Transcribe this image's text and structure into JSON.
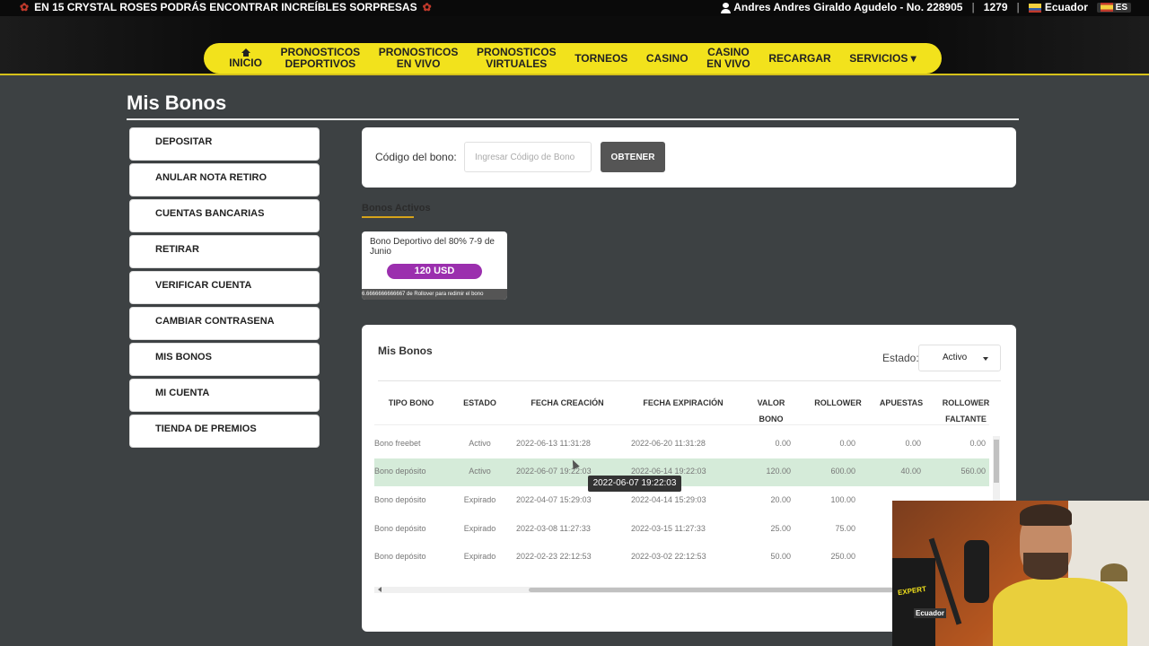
{
  "topbar": {
    "promo_text": "EN 15 CRYSTAL ROSES PODRÁS ENCONTRAR INCREÍBLES SORPRESAS",
    "user_name": "Andres Andres Giraldo Agudelo - No. 228905",
    "balance": "1279",
    "country": "Ecuador",
    "language": "ES"
  },
  "nav": [
    {
      "label": "INICIO",
      "icon": "home-icon"
    },
    {
      "label": "PRONOSTICOS\nDEPORTIVOS"
    },
    {
      "label": "PRONOSTICOS\nEN VIVO"
    },
    {
      "label": "PRONOSTICOS\nVIRTUALES"
    },
    {
      "label": "TORNEOS"
    },
    {
      "label": "CASINO"
    },
    {
      "label": "CASINO\nEN VIVO"
    },
    {
      "label": "RECARGAR"
    },
    {
      "label": "SERVICIOS ▾"
    }
  ],
  "page_title": "Mis Bonos",
  "sidebar": {
    "items": [
      {
        "label": "DEPOSITAR"
      },
      {
        "label": "ANULAR NOTA RETIRO"
      },
      {
        "label": "CUENTAS BANCARIAS"
      },
      {
        "label": "RETIRAR"
      },
      {
        "label": "VERIFICAR CUENTA"
      },
      {
        "label": "CAMBIAR CONTRASENA"
      },
      {
        "label": "MIS BONOS"
      },
      {
        "label": "MI CUENTA"
      },
      {
        "label": "TIENDA DE PREMIOS"
      }
    ]
  },
  "code_form": {
    "label": "Código del bono:",
    "placeholder": "Ingresar Código de Bono",
    "button": "OBTENER"
  },
  "active_bonuses": {
    "heading": "Bonos Activos",
    "card": {
      "name": "Bono Deportivo del 80% 7-9 de Junio",
      "amount": "120 USD",
      "footer": "6.6666666666667 de Rollover para redimir el bono"
    }
  },
  "my_bonuses": {
    "title": "Mis Bonos",
    "estado_label": "Estado:",
    "estado_value": "Activo",
    "columns": [
      "TIPO BONO",
      "ESTADO",
      "FECHA CREACIÓN",
      "FECHA EXPIRACIÓN",
      "VALOR\nBONO",
      "ROLLOWER",
      "APUESTAS",
      "ROLLOWER\nFALTANTE"
    ],
    "rows": [
      [
        "Bono freebet",
        "Activo",
        "2022-06-13 11:31:28",
        "2022-06-20 11:31:28",
        "0.00",
        "0.00",
        "0.00",
        "0.00"
      ],
      [
        "Bono depósito",
        "Activo",
        "2022-06-07 19:22:03",
        "2022-06-14 19:22:03",
        "120.00",
        "600.00",
        "40.00",
        "560.00"
      ],
      [
        "Bono depósito",
        "Expirado",
        "2022-04-07 15:29:03",
        "2022-04-14 15:29:03",
        "20.00",
        "100.00",
        "",
        ""
      ],
      [
        "Bono depósito",
        "Expirado",
        "2022-03-08 11:27:33",
        "2022-03-15 11:27:33",
        "25.00",
        "75.00",
        "",
        ""
      ],
      [
        "Bono depósito",
        "Expirado",
        "2022-02-23 22:12:53",
        "2022-03-02 22:12:53",
        "50.00",
        "250.00",
        "",
        ""
      ]
    ],
    "tooltip": "2022-06-07 19:22:03"
  },
  "webcam": {
    "banner_text": "EXPERT",
    "banner_text2": "Ecuador"
  }
}
